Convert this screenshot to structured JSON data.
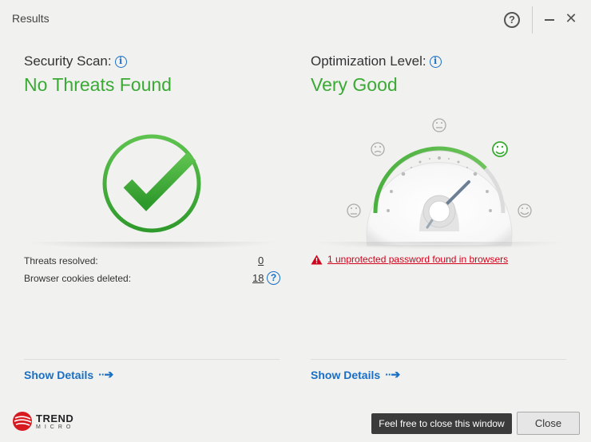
{
  "window": {
    "title": "Results",
    "help_glyph": "?",
    "close_glyph": "✕"
  },
  "security": {
    "label": "Security Scan:",
    "status": "No Threats Found",
    "stats": [
      {
        "label": "Threats resolved:",
        "value": "0"
      },
      {
        "label": "Browser cookies deleted:",
        "value": "18"
      }
    ],
    "details_label": "Show Details"
  },
  "optimization": {
    "label": "Optimization Level:",
    "status": "Very Good",
    "gauge_level": 0.8,
    "warning": "1 unprotected password found in browsers",
    "details_label": "Show Details"
  },
  "footer": {
    "logo_line1": "TREND",
    "logo_line2": "MICRO",
    "tooltip": "Feel free to close this window",
    "close_label": "Close"
  },
  "colors": {
    "accent_green": "#3aaa35",
    "link_blue": "#1a6fc4",
    "warning_red": "#d0021b",
    "brand_red": "#d71920"
  }
}
